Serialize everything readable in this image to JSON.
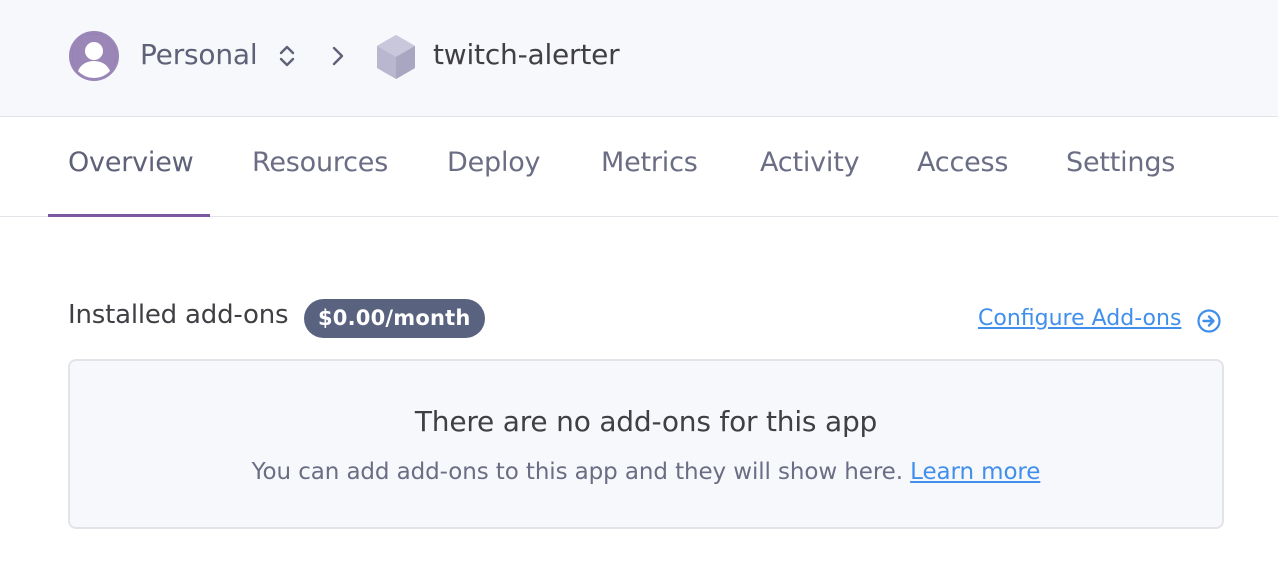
{
  "header": {
    "account_label": "Personal",
    "app_name": "twitch-alerter",
    "icons": [
      "avatar-icon",
      "updown-chevron-icon",
      "chevron-right-icon",
      "hexagon-app-icon"
    ]
  },
  "tabs": [
    {
      "label": "Overview",
      "active": true
    },
    {
      "label": "Resources"
    },
    {
      "label": "Deploy"
    },
    {
      "label": "Metrics"
    },
    {
      "label": "Activity"
    },
    {
      "label": "Access"
    },
    {
      "label": "Settings"
    }
  ],
  "addons": {
    "title": "Installed add-ons",
    "price_badge": "$0.00/month",
    "configure_label": "Configure Add-ons",
    "empty_title": "There are no add-ons for this app",
    "empty_text": "You can add add-ons to this app and they will show here.",
    "learn_more": "Learn more"
  },
  "colors": {
    "brand_purple": "#79589f",
    "link_blue": "#408fec",
    "badge_bg": "#596380"
  }
}
